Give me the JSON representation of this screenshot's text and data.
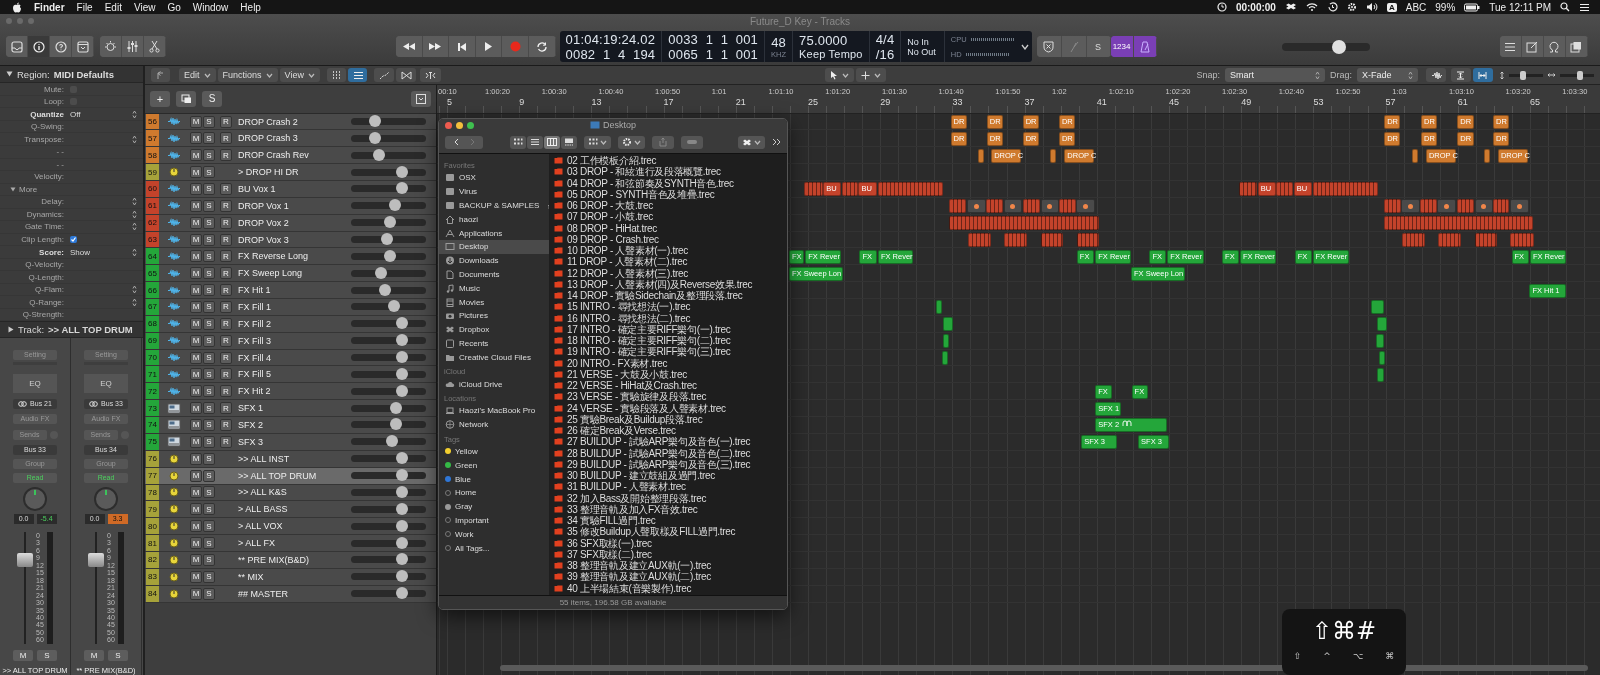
{
  "menubar": {
    "app": "Finder",
    "menus": [
      "File",
      "Edit",
      "View",
      "Go",
      "Window",
      "Help"
    ],
    "timer": "00:00:00",
    "input_badge": "A",
    "input_source": "ABC",
    "battery": "99%",
    "clock": "Tue 12:11 PM"
  },
  "window": {
    "title": "Future_D Key - Tracks"
  },
  "toolbar": {
    "view_buttons": [
      {
        "kind": "library",
        "selected": false
      },
      {
        "kind": "inspector",
        "selected": true
      },
      {
        "kind": "help",
        "selected": false
      },
      {
        "kind": "toolbar",
        "selected": false
      }
    ],
    "lcd": {
      "time": "01:04:19:24.02",
      "position": "0082  1  4  194",
      "locator_start": "0033  1  1  001",
      "locator_end": "0065  1  1  001",
      "sample_rate": "48",
      "sample_rate_unit": "KHZ",
      "tempo": "75.0000",
      "tempo_mode": "Keep Tempo",
      "signature": "4/4",
      "division": "/16",
      "input": "No In",
      "output": "No Out",
      "cpu_label": "CPU",
      "hd_label": "HD"
    },
    "solo_label": "S",
    "count_in": "1234",
    "master_volume": {
      "level": 0.68
    }
  },
  "control_bar": {
    "menus": [
      "Edit",
      "Functions",
      "View"
    ],
    "view_toggles": [
      {
        "selected": false
      },
      {
        "selected": true
      }
    ],
    "snap_label": "Snap:",
    "snap": "Smart",
    "drag_label": "Drag:",
    "drag": "X-Fade",
    "fit_toggles": [
      {
        "selected": false
      },
      {
        "selected": true
      }
    ],
    "zoom_sliders": [
      {
        "level": 0.4
      },
      {
        "level": 0.6
      }
    ]
  },
  "inspector": {
    "region_label": "Region:",
    "region_name": "MIDI Defaults",
    "params": [
      {
        "kind": "checkbox",
        "label": "Mute:",
        "checked": false
      },
      {
        "kind": "checkbox",
        "label": "Loop:",
        "checked": false
      },
      {
        "kind": "select",
        "label": "Quantize",
        "value": "Off"
      },
      {
        "kind": "field",
        "label": "Q-Swing:"
      },
      {
        "kind": "select",
        "label": "Transpose:"
      },
      {
        "kind": "field",
        "label": "- -"
      },
      {
        "kind": "field",
        "label": "- -"
      },
      {
        "kind": "field",
        "label": "Velocity:"
      },
      {
        "kind": "section",
        "label": "More"
      },
      {
        "kind": "select",
        "label": "Delay:"
      },
      {
        "kind": "select",
        "label": "Dynamics:"
      },
      {
        "kind": "select",
        "label": "Gate Time:"
      },
      {
        "kind": "checkbox",
        "label": "Clip Length:",
        "checked": true
      },
      {
        "kind": "select",
        "label": "Score:",
        "value": "Show"
      },
      {
        "kind": "field",
        "label": "Q-Velocity:"
      },
      {
        "kind": "field",
        "label": "Q-Length:"
      },
      {
        "kind": "select",
        "label": "Q-Flam:"
      },
      {
        "kind": "select",
        "label": "Q-Range:"
      },
      {
        "kind": "field",
        "label": "Q-Strength:"
      }
    ],
    "track_label": "Track:",
    "track_name": ">> ALL TOP DRUM",
    "strips": [
      {
        "setting": "Setting",
        "eq": "EQ",
        "input": "Bus 21",
        "audio_fx": "Audio FX",
        "sends": "Sends",
        "output": "Bus 33",
        "group": "Group",
        "automation": "Read",
        "volume": "0.0",
        "peak": "-5.4",
        "clipping": false,
        "fader": {
          "level": 0.78
        },
        "meter_scale": [
          "0",
          "3",
          "6",
          "9",
          "12",
          "15",
          "18",
          "21",
          "24",
          "30",
          "35",
          "40",
          "45",
          "50",
          "60"
        ],
        "mute": "M",
        "solo": "S",
        "name": ">> ALL TOP DRUM"
      },
      {
        "setting": "Setting",
        "eq": "EQ",
        "input": "Bus 33",
        "audio_fx": "Audio FX",
        "sends": "Sends",
        "output": "Bus 34",
        "group": "Group",
        "automation": "Read",
        "volume": "0.0",
        "peak": "3.3",
        "clipping": true,
        "fader": {
          "level": 0.78
        },
        "meter_scale": [
          "0",
          "3",
          "6",
          "9",
          "12",
          "15",
          "18",
          "21",
          "24",
          "30",
          "35",
          "40",
          "45",
          "50",
          "60"
        ],
        "mute": "M",
        "solo": "S",
        "name": "** PRE MIX(B&D)"
      }
    ]
  },
  "tracks_header": {
    "add": "+",
    "solo": "S"
  },
  "tracks": [
    {
      "number": "56",
      "color": "#cf7a2e",
      "kind": "audio",
      "name": "DROP Crash 2",
      "m": "M",
      "s": "S",
      "r": "R",
      "level": 0.28,
      "selected": false,
      "regions": [
        {
          "label": "DR"
        },
        {
          "label": "DR"
        },
        {
          "label": "DR"
        },
        {
          "label": "DR"
        },
        {
          "label": "DR"
        },
        {
          "label": "DR"
        },
        {
          "label": "DR"
        },
        {
          "label": "DR"
        }
      ]
    },
    {
      "number": "57",
      "color": "#cf7a2e",
      "kind": "audio",
      "name": "DROP Crash 3",
      "m": "M",
      "s": "S",
      "r": "R",
      "level": 0.29,
      "selected": false,
      "regions": [
        {
          "label": "DR"
        },
        {
          "label": "DR"
        },
        {
          "label": "DR"
        },
        {
          "label": "DR"
        },
        {
          "label": "DR"
        },
        {
          "label": "DR"
        },
        {
          "label": "DR"
        },
        {
          "label": "DR"
        }
      ]
    },
    {
      "number": "58",
      "color": "#cf7a2e",
      "kind": "audio",
      "name": "DROP Crash Rev",
      "m": "M",
      "s": "S",
      "r": "R",
      "level": 0.35,
      "selected": false,
      "regions": [
        {
          "label": "DROP C"
        },
        {
          "label": "DROP C"
        },
        {
          "label": "DROP C"
        },
        {
          "label": "DROP C"
        }
      ]
    },
    {
      "number": "59",
      "color": "#a6a23a",
      "kind": "aux",
      "name": "> DROP HI DR",
      "m": "M",
      "s": "S",
      "level": 0.72,
      "selected": false
    },
    {
      "number": "60",
      "color": "#c4432b",
      "kind": "audio",
      "name": "BU Vox 1",
      "m": "M",
      "s": "S",
      "r": "R",
      "level": 0.72,
      "selected": false,
      "regions": [
        {
          "label": "BU"
        },
        {
          "label": "BU"
        },
        {
          "label": "BU"
        },
        {
          "label": "BU"
        }
      ]
    },
    {
      "number": "61",
      "color": "#c4432b",
      "kind": "audio",
      "name": "DROP Vox 1",
      "m": "M",
      "s": "S",
      "r": "R",
      "level": 0.61,
      "selected": false
    },
    {
      "number": "62",
      "color": "#c4432b",
      "kind": "audio",
      "name": "DROP Vox 2",
      "m": "M",
      "s": "S",
      "r": "R",
      "level": 0.53,
      "selected": false
    },
    {
      "number": "63",
      "color": "#c4432b",
      "kind": "audio",
      "name": "DROP Vox 3",
      "m": "M",
      "s": "S",
      "r": "R",
      "level": 0.47,
      "selected": false
    },
    {
      "number": "64",
      "color": "#24a63a",
      "kind": "audio",
      "name": "FX Reverse Long",
      "m": "M",
      "s": "S",
      "r": "R",
      "level": 0.52,
      "selected": false,
      "regions": [
        {
          "label": "FX"
        },
        {
          "label": "FX Rever"
        },
        {
          "label": "FX"
        },
        {
          "label": "FX Rever"
        },
        {
          "label": "FX"
        },
        {
          "label": "FX Rever"
        },
        {
          "label": "FX"
        },
        {
          "label": "FX Rever"
        },
        {
          "label": "FX"
        },
        {
          "label": "FX Rever"
        },
        {
          "label": "FX"
        },
        {
          "label": "FX Rever"
        },
        {
          "label": "FX"
        },
        {
          "label": "FX Rever"
        }
      ]
    },
    {
      "number": "65",
      "color": "#24a63a",
      "kind": "audio",
      "name": "FX Sweep Long",
      "m": "M",
      "s": "S",
      "r": "R",
      "level": 0.38,
      "selected": false,
      "regions": [
        {
          "label": "FX Sweep Lon"
        },
        {
          "label": "FX Sweep Lon"
        }
      ]
    },
    {
      "number": "66",
      "color": "#24a63a",
      "kind": "audio",
      "name": "FX Hit 1",
      "m": "M",
      "s": "S",
      "r": "R",
      "level": 0.45,
      "selected": false,
      "regions": [
        {
          "label": "FX Hit 1"
        }
      ]
    },
    {
      "number": "67",
      "color": "#24a63a",
      "kind": "audio",
      "name": "FX Fill 1",
      "m": "M",
      "s": "S",
      "r": "R",
      "level": 0.59,
      "selected": false
    },
    {
      "number": "68",
      "color": "#24a63a",
      "kind": "audio",
      "name": "FX Fill 2",
      "m": "M",
      "s": "S",
      "r": "R",
      "level": 0.72,
      "selected": false
    },
    {
      "number": "69",
      "color": "#24a63a",
      "kind": "audio",
      "name": "FX Fill 3",
      "m": "M",
      "s": "S",
      "r": "R",
      "level": 0.72,
      "selected": false
    },
    {
      "number": "70",
      "color": "#24a63a",
      "kind": "audio",
      "name": "FX Fill 4",
      "m": "M",
      "s": "S",
      "r": "R",
      "level": 0.72,
      "selected": false
    },
    {
      "number": "71",
      "color": "#24a63a",
      "kind": "audio",
      "name": "FX Fill 5",
      "m": "M",
      "s": "S",
      "r": "R",
      "level": 0.72,
      "selected": false
    },
    {
      "number": "72",
      "color": "#24a63a",
      "kind": "audio",
      "name": "FX Hit 2",
      "m": "M",
      "s": "S",
      "r": "R",
      "level": 0.72,
      "selected": false,
      "regions": [
        {
          "label": "FX"
        },
        {
          "label": "FX"
        }
      ]
    },
    {
      "number": "73",
      "color": "#24a63a",
      "kind": "sampler",
      "name": "SFX 1",
      "m": "M",
      "s": "S",
      "r": "R",
      "level": 0.62,
      "selected": false,
      "regions": [
        {
          "label": "SFX 1"
        }
      ]
    },
    {
      "number": "74",
      "color": "#24a63a",
      "kind": "sampler",
      "name": "SFX 2",
      "m": "M",
      "s": "S",
      "r": "R",
      "level": 0.62,
      "selected": false,
      "regions": [
        {
          "label": "SFX 2",
          "linked": true
        }
      ]
    },
    {
      "number": "75",
      "color": "#24a63a",
      "kind": "sampler",
      "name": "SFX 3",
      "m": "M",
      "s": "S",
      "r": "R",
      "level": 0.55,
      "selected": false,
      "regions": [
        {
          "label": "SFX 3"
        },
        {
          "label": "SFX 3"
        }
      ]
    },
    {
      "number": "76",
      "color": "#a6a23a",
      "kind": "aux",
      "name": ">> ALL INST",
      "m": "M",
      "s": "S",
      "level": 0.72,
      "selected": false
    },
    {
      "number": "77",
      "color": "#a6a23a",
      "kind": "aux",
      "name": ">> ALL TOP DRUM",
      "m": "M",
      "s": "S",
      "level": 0.72,
      "selected": true
    },
    {
      "number": "78",
      "color": "#a6a23a",
      "kind": "aux",
      "name": ">> ALL K&S",
      "m": "M",
      "s": "S",
      "level": 0.72,
      "selected": false
    },
    {
      "number": "79",
      "color": "#a6a23a",
      "kind": "aux",
      "name": "> ALL BASS",
      "m": "M",
      "s": "S",
      "level": 0.72,
      "selected": false
    },
    {
      "number": "80",
      "color": "#a6a23a",
      "kind": "aux",
      "name": "> ALL VOX",
      "m": "M",
      "s": "S",
      "level": 0.72,
      "selected": false
    },
    {
      "number": "81",
      "color": "#a6a23a",
      "kind": "aux",
      "name": "> ALL FX",
      "m": "M",
      "s": "S",
      "level": 0.72,
      "selected": false
    },
    {
      "number": "82",
      "color": "#a6a23a",
      "kind": "aux",
      "name": "** PRE MIX(B&D)",
      "m": "M",
      "s": "S",
      "level": 0.72,
      "selected": false
    },
    {
      "number": "83",
      "color": "#a6a23a",
      "kind": "aux",
      "name": "** MIX",
      "m": "M",
      "s": "S",
      "level": 0.72,
      "selected": false
    },
    {
      "number": "84",
      "color": "#a6a23a",
      "kind": "aux",
      "name": "## MASTER",
      "m": "M",
      "s": "S",
      "level": 0.72,
      "selected": false
    }
  ],
  "ruler": {
    "timecodes": [
      "00:10",
      "1:00:20",
      "1:00:30",
      "1:00:40",
      "1:00:50",
      "1:01",
      "1:01:10",
      "1:01:20",
      "1:01:30",
      "1:01:40",
      "1:01:50",
      "1:02",
      "1:02:10",
      "1:02:20",
      "1:02:30",
      "1:02:40",
      "1:02:50",
      "1:03",
      "1:03:10",
      "1:03:20",
      "1:03:30"
    ],
    "bars": [
      "5",
      "9",
      "13",
      "17",
      "21",
      "25",
      "29",
      "33",
      "37",
      "41",
      "45",
      "49",
      "53",
      "57",
      "61",
      "65"
    ]
  },
  "finder": {
    "title": "Desktop",
    "view_modes": [
      {
        "kind": "icons",
        "selected": false
      },
      {
        "kind": "list",
        "selected": false
      },
      {
        "kind": "columns",
        "selected": true
      },
      {
        "kind": "gallery",
        "selected": false
      }
    ],
    "sidebar": [
      {
        "heading": "Favorites",
        "items": [
          {
            "label": "OSX",
            "kind": "drive",
            "selected": false
          },
          {
            "label": "Virus",
            "kind": "drive",
            "selected": false
          },
          {
            "label": "BACKUP & SAMPLES",
            "kind": "external_drive",
            "selected": false
          },
          {
            "label": "haozi",
            "kind": "home",
            "selected": false
          },
          {
            "label": "Applications",
            "kind": "apps",
            "selected": false
          },
          {
            "label": "Desktop",
            "kind": "desktop",
            "selected": true
          },
          {
            "label": "Downloads",
            "kind": "download",
            "selected": false
          },
          {
            "label": "Documents",
            "kind": "document",
            "selected": false
          },
          {
            "label": "Music",
            "kind": "music",
            "selected": false
          },
          {
            "label": "Movies",
            "kind": "movie",
            "selected": false
          },
          {
            "label": "Pictures",
            "kind": "picture",
            "selected": false
          },
          {
            "label": "Dropbox",
            "kind": "dropbox",
            "selected": false
          },
          {
            "label": "Recents",
            "kind": "recents",
            "selected": false
          },
          {
            "label": "Creative Cloud Files",
            "kind": "folder",
            "selected": false
          }
        ]
      },
      {
        "heading": "iCloud",
        "items": [
          {
            "label": "iCloud Drive",
            "kind": "cloud",
            "selected": false
          }
        ]
      },
      {
        "heading": "Locations",
        "items": [
          {
            "label": "Haozi's MacBook Pro",
            "kind": "laptop",
            "selected": false
          },
          {
            "label": "Network",
            "kind": "network",
            "selected": false
          }
        ]
      },
      {
        "heading": "Tags",
        "items": [
          {
            "label": "Yellow",
            "kind": "tag",
            "color": "#f2cf2f",
            "selected": false
          },
          {
            "label": "Green",
            "kind": "tag",
            "color": "#35b946",
            "selected": false
          },
          {
            "label": "Blue",
            "kind": "tag",
            "color": "#2f76d6",
            "selected": false
          },
          {
            "label": "Home",
            "kind": "empty_tag",
            "selected": false
          },
          {
            "label": "Gray",
            "kind": "tag",
            "color": "#9a9a9a",
            "selected": false
          },
          {
            "label": "Important",
            "kind": "empty_tag",
            "selected": false
          },
          {
            "label": "Work",
            "kind": "empty_tag",
            "selected": false
          },
          {
            "label": "All Tags...",
            "kind": "empty_tag",
            "selected": false
          }
        ]
      }
    ],
    "files": [
      "02 工作模板介紹.trec",
      "03 DROP - 和絃進行及段落概覽.trec",
      "04 DROP - 和弦節奏及SYNTH音色.trec",
      "05 DROP - SYNTH音色及堆疊.trec",
      "06 DROP - 大鼓.trec",
      "07 DROP - 小鼓.trec",
      "08 DROP - HiHat.trec",
      "09 DROP - Crash.trec",
      "10 DROP - 人聲素材(一).trec",
      "11 DROP - 人聲素材(二).trec",
      "12 DROP - 人聲素材(三).trec",
      "13 DROP - 人聲素材(四)及Reverse效果.trec",
      "14 DROP - 實驗Sidechain及整理段落.trec",
      "15 INTRO - 尋找想法(一).trec",
      "16 INTRO - 尋找想法(二).trec",
      "17 INTRO - 確定主要RIFF樂句(一).trec",
      "18 INTRO - 確定主要RIFF樂句(二).trec",
      "19 INTRO - 確定主要RIFF樂句(三).trec",
      "20 INTRO - FX素材.trec",
      "21 VERSE - 大鼓及小鼓.trec",
      "22 VERSE - HiHat及Crash.trec",
      "23 VERSE - 實驗旋律及段落.trec",
      "24 VERSE - 實驗段落及人聲素材.trec",
      "25 實驗Break及Buildup段落.trec",
      "26 確定Break及Verse.trec",
      "27 BUILDUP - 試驗ARP樂句及音色(一).trec",
      "28 BUILDUP - 試驗ARP樂句及音色(二).trec",
      "29 BUILDUP - 試驗ARP樂句及音色(三).trec",
      "30 BUILDUP - 建立鼓組及過門.trec",
      "31 BUILDUP - 人聲素材.trec",
      "32 加入Bass及開始整理段落.trec",
      "33 整理音軌及加入FX音效.trec",
      "34 實驗FILL過門.trec",
      "35 修改Buildup人聲取樣及FILL過門.trec",
      "36 SFX取樣(一).trec",
      "37 SFX取樣(二).trec",
      "38 整理音軌及建立AUX軌(一).trec",
      "39 整理音軌及建立AUX軌(二).trec",
      "40 上半場結束(音樂製作).trec"
    ],
    "status": "55 items, 196.58 GB available"
  },
  "key_overlay": {
    "combo": "⇧⌘#",
    "keys": [
      "⇧",
      "^",
      "⌥",
      "⌘"
    ]
  }
}
